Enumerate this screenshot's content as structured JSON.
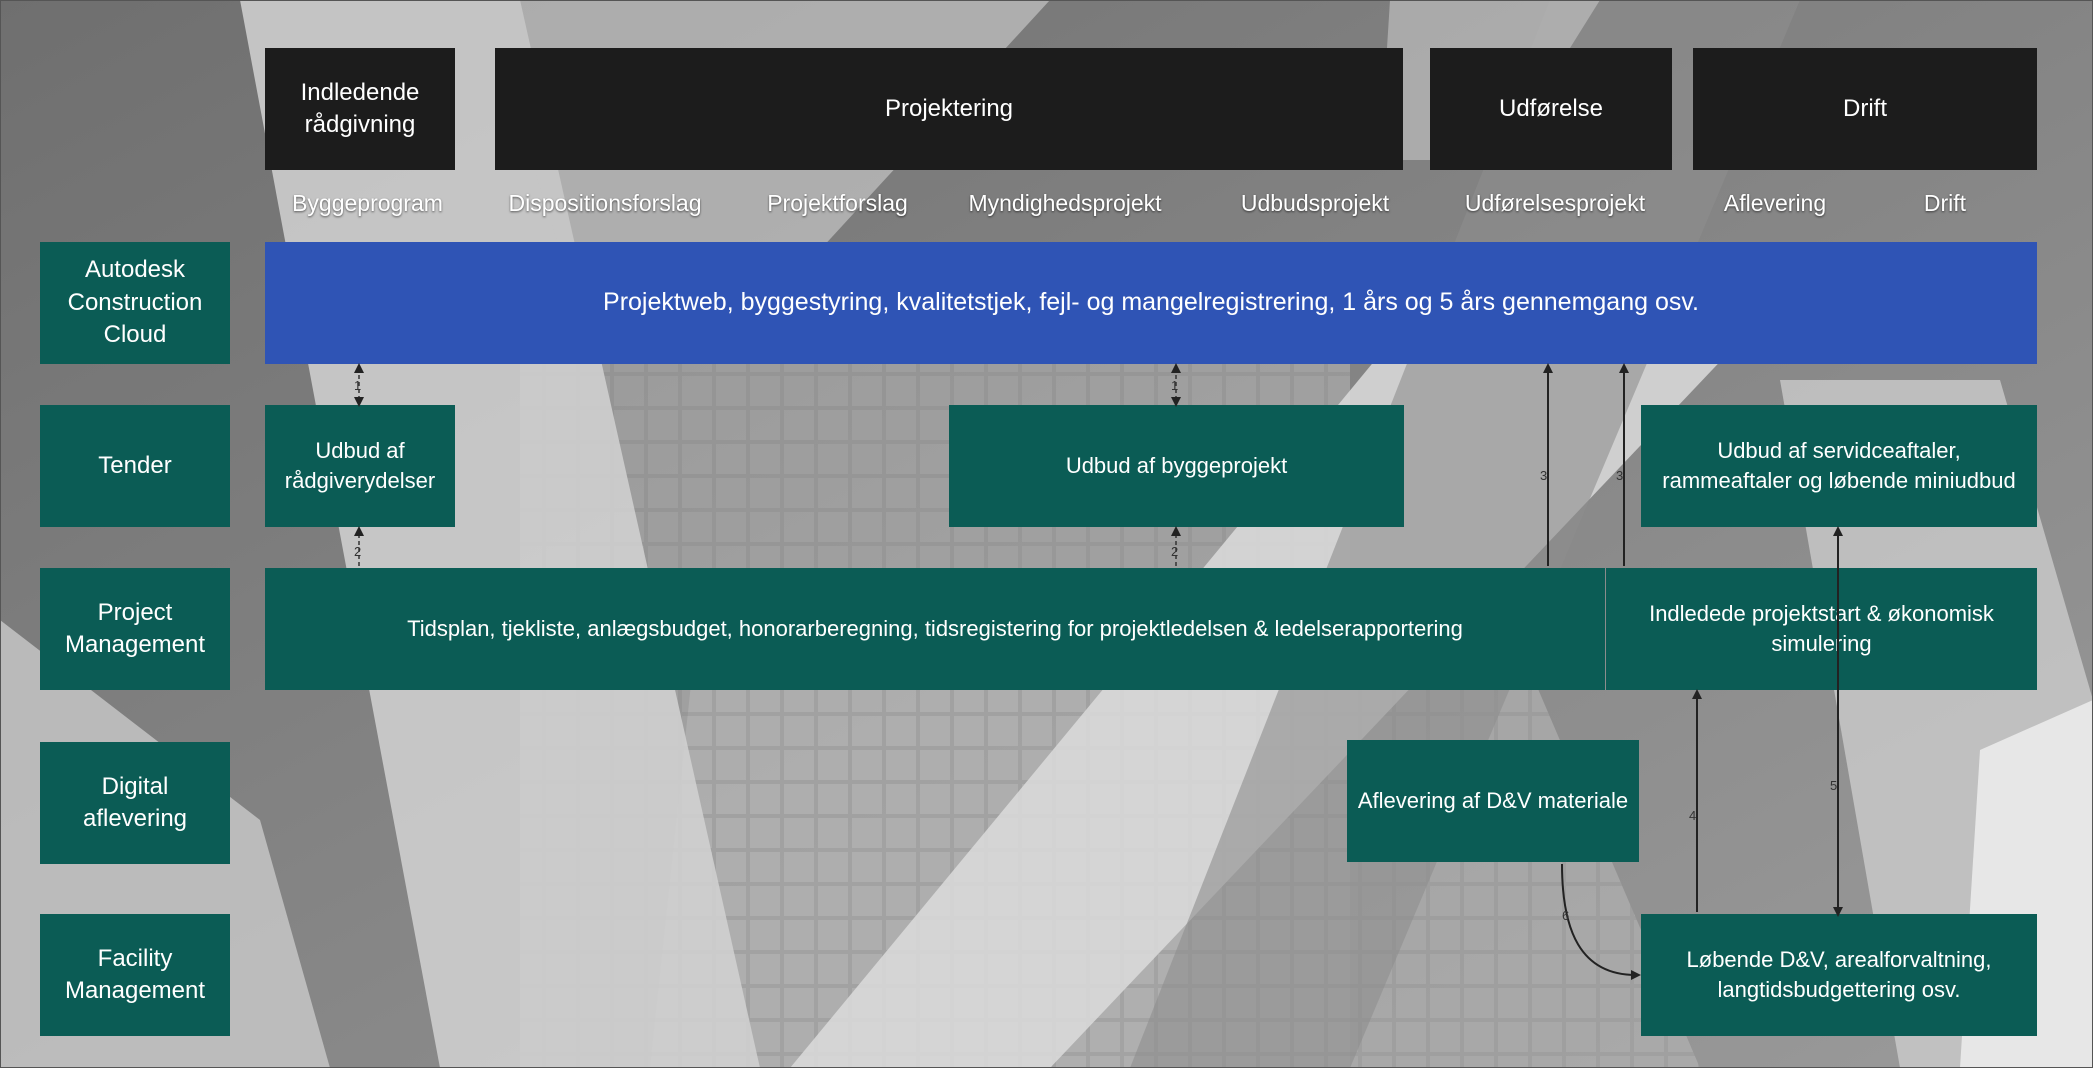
{
  "phases": [
    {
      "label": "Indledende rådgivning"
    },
    {
      "label": "Projektering"
    },
    {
      "label": "Udførelse"
    },
    {
      "label": "Drift"
    }
  ],
  "subphases": [
    "Byggeprogram",
    "Dispositionsforslag",
    "Projektforslag",
    "Myndighedsprojekt",
    "Udbudsprojekt",
    "Udførelsesprojekt",
    "Aflevering",
    "Drift"
  ],
  "rows": [
    {
      "label": "Autodesk Construction Cloud"
    },
    {
      "label": "Tender"
    },
    {
      "label": "Project Management"
    },
    {
      "label": "Digital aflevering"
    },
    {
      "label": "Facility Management"
    }
  ],
  "boxes": {
    "acc": "Projektweb, byggestyring, kvalitetstjek, fejl- og mangelregistrering, 1 års og 5 års gennemgang osv.",
    "tender_advisory": "Udbud af rådgiverydelser",
    "tender_build": "Udbud af byggeprojekt",
    "tender_service": "Udbud af servidceaftaler, rammeaftaler og løbende miniudbud",
    "pm_main": "Tidsplan, tjekliste, anlægsbudget, honorarberegning, tidsregistering for projektledelsen & ledelserapportering",
    "pm_start": "Indledede projektstart & økonomisk simulering",
    "digital": "Aflevering af D&V materiale",
    "fm": "Løbende D&V, arealforvaltning, langtidsbudgettering osv."
  },
  "connector_labels": [
    "1",
    "1",
    "2",
    "2",
    "3",
    "3",
    "4",
    "5",
    "6"
  ],
  "colors": {
    "phase_bg": "#1c1c1c",
    "acc_blue": "#2f54b5",
    "teal": "#0b5c55"
  }
}
